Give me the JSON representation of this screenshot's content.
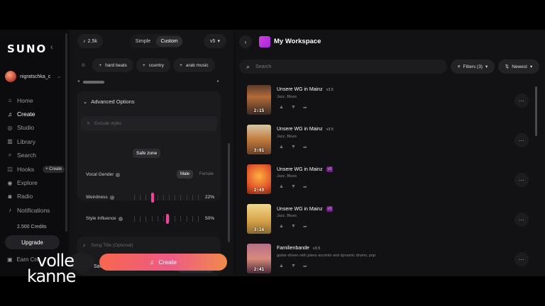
{
  "sidebar": {
    "logo": "SUNO",
    "collapse_icon": "chevron-left-icon",
    "username": "nigratschka_c",
    "nav": [
      {
        "label": "Home",
        "icon": "home-icon",
        "glyph": "⌂"
      },
      {
        "label": "Create",
        "icon": "music-note-icon",
        "glyph": "♫"
      },
      {
        "label": "Studio",
        "icon": "studio-icon",
        "glyph": "◎"
      },
      {
        "label": "Library",
        "icon": "library-icon",
        "glyph": "▥"
      },
      {
        "label": "Search",
        "icon": "search-icon",
        "glyph": "⌕"
      },
      {
        "label": "Hooks",
        "icon": "hooks-icon",
        "glyph": "◫"
      },
      {
        "label": "Explore",
        "icon": "compass-icon",
        "glyph": "◉"
      },
      {
        "label": "Radio",
        "icon": "radio-icon",
        "glyph": "◙"
      },
      {
        "label": "Notifications",
        "icon": "bell-icon",
        "glyph": "♪"
      }
    ],
    "hooks_badge": "+ Create",
    "credits": "2.500 Credits",
    "upgrade": "Upgrade",
    "earn": "Earn Cre"
  },
  "mid": {
    "credit_chip": "2.5k",
    "mode_simple": "Simple",
    "mode_custom": "Custom",
    "version": "v5",
    "tags": [
      "hard beats",
      "country",
      "arab music"
    ],
    "advanced_options": "Advanced Options",
    "exclude_placeholder": "Exclude styles",
    "vocal_gender_label": "Vocal Gender",
    "gender_male": "Male",
    "gender_female": "Female",
    "weirdness_label": "Weirdness",
    "weirdness_value": 22,
    "weirdness_pct": "22%",
    "style_influence_label": "Style Influence",
    "style_influence_value": 50,
    "style_influence_pct": "50%",
    "tooltip": "Safe zone",
    "song_title_placeholder": "Song Title (Optional)",
    "save_to": "Save to...",
    "workspace_button": "My Workspace",
    "create": "Create"
  },
  "workspace": {
    "title": "My Workspace",
    "search_placeholder": "Search",
    "filters": "Filters (3)",
    "sort": "Newest",
    "songs": [
      {
        "title": "Unsere WG in Mainz",
        "version": "v3.5",
        "highlight": false,
        "genre": "Jazz, Blues",
        "duration": "2:15"
      },
      {
        "title": "Unsere WG in Mainz",
        "version": "v3.5",
        "highlight": false,
        "genre": "Jazz, Blues",
        "duration": "3:01"
      },
      {
        "title": "Unsere WG in Mainz",
        "version": "v5",
        "highlight": true,
        "genre": "Jazz, Blues",
        "duration": "2:49"
      },
      {
        "title": "Unsere WG in Mainz",
        "version": "v5",
        "highlight": true,
        "genre": "Jazz, Blues",
        "duration": "3:16"
      },
      {
        "title": "Familienbande",
        "version": "v3.5",
        "highlight": false,
        "genre": "guitar-driven with piano accents and dynamic drums, pop",
        "duration": "2:41"
      }
    ]
  },
  "watermark": {
    "line1": "volle",
    "line2": "kanne"
  }
}
